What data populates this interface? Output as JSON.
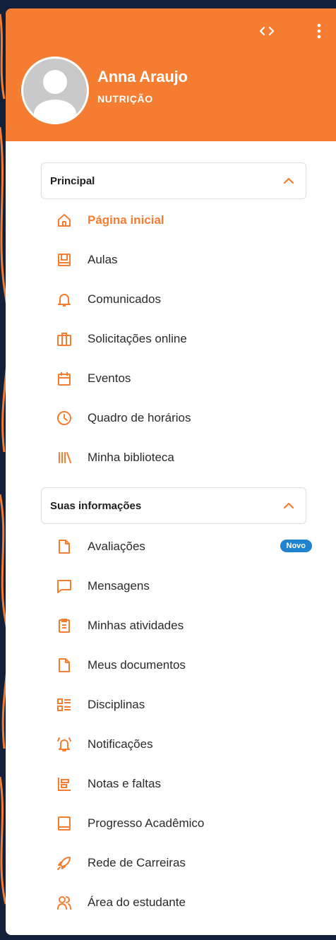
{
  "header": {
    "code_icon": "code-brackets-icon",
    "more_icon": "kebab-menu-icon",
    "user_name": "Anna Araujo",
    "user_course": "NUTRIÇÃO"
  },
  "sections": {
    "principal": {
      "title": "Principal",
      "items": [
        {
          "label": "Página inicial",
          "icon": "home-icon",
          "active": true
        },
        {
          "label": "Aulas",
          "icon": "book-icon"
        },
        {
          "label": "Comunicados",
          "icon": "bell-icon"
        },
        {
          "label": "Solicitações online",
          "icon": "briefcase-icon"
        },
        {
          "label": "Eventos",
          "icon": "calendar-icon"
        },
        {
          "label": "Quadro de horários",
          "icon": "clock-icon"
        },
        {
          "label": "Minha biblioteca",
          "icon": "library-icon"
        }
      ]
    },
    "info": {
      "title": "Suas informações",
      "items": [
        {
          "label": "Avaliações",
          "icon": "document-icon",
          "badge": "Novo"
        },
        {
          "label": "Mensagens",
          "icon": "message-icon"
        },
        {
          "label": "Minhas atividades",
          "icon": "clipboard-icon"
        },
        {
          "label": "Meus documentos",
          "icon": "document-icon"
        },
        {
          "label": "Disciplinas",
          "icon": "list-icon"
        },
        {
          "label": "Notificações",
          "icon": "bell-ringing-icon"
        },
        {
          "label": "Notas e faltas",
          "icon": "bar-chart-icon"
        },
        {
          "label": "Progresso Acadêmico",
          "icon": "notebook-icon"
        },
        {
          "label": "Rede de Carreiras",
          "icon": "rocket-icon"
        },
        {
          "label": "Área do estudante",
          "icon": "users-icon"
        }
      ]
    }
  },
  "colors": {
    "accent": "#f47d31",
    "background": "#13203a",
    "badge": "#1f82cf"
  }
}
